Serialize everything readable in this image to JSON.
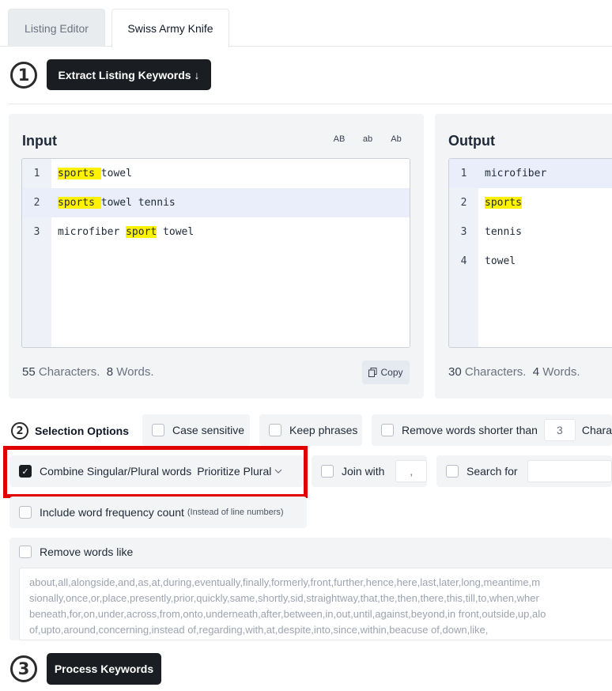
{
  "tabs": [
    {
      "label": "Listing Editor",
      "active": false
    },
    {
      "label": "Swiss Army Knife",
      "active": true
    }
  ],
  "step1": {
    "number": "1",
    "button": "Extract Listing Keywords ↓"
  },
  "input": {
    "title": "Input",
    "case_buttons": [
      "AB",
      "ab",
      "Ab"
    ],
    "lines": [
      {
        "n": "1",
        "parts": [
          {
            "t": "sports ",
            "hl": true
          },
          {
            "t": "towel",
            "hl": false
          }
        ]
      },
      {
        "n": "2",
        "parts": [
          {
            "t": "sports ",
            "hl": true
          },
          {
            "t": "towel tennis",
            "hl": false
          }
        ]
      },
      {
        "n": "3",
        "parts": [
          {
            "t": "microfiber ",
            "hl": false
          },
          {
            "t": "sport",
            "hl": true
          },
          {
            "t": " towel",
            "hl": false
          }
        ]
      }
    ],
    "char_count": "55",
    "char_label": "Characters.",
    "word_count": "8",
    "word_label": "Words.",
    "copy_label": "Copy"
  },
  "output": {
    "title": "Output",
    "lines": [
      {
        "n": "1",
        "parts": [
          {
            "t": "microfiber",
            "hl": false
          }
        ]
      },
      {
        "n": "2",
        "parts": [
          {
            "t": "sports",
            "hl": true
          }
        ]
      },
      {
        "n": "3",
        "parts": [
          {
            "t": "tennis",
            "hl": false
          }
        ]
      },
      {
        "n": "4",
        "parts": [
          {
            "t": "towel",
            "hl": false
          }
        ]
      }
    ],
    "char_count": "30",
    "char_label": "Characters.",
    "word_count": "4",
    "word_label": "Words."
  },
  "options": {
    "step_number": "2",
    "label": "Selection Options",
    "case_sensitive": "Case sensitive",
    "keep_phrases": "Keep phrases",
    "remove_shorter": "Remove words shorter than",
    "remove_shorter_value": "3",
    "remove_shorter_suffix": "Chara",
    "combine": "Combine Singular/Plural words",
    "prioritize": "Prioritize Plural",
    "join_with": "Join with",
    "join_value": ",",
    "search_for": "Search for",
    "include_freq": "Include word frequency count",
    "include_freq_note": "(Instead of line numbers)",
    "remove_like": "Remove words like",
    "remove_like_lines": [
      "about,all,alongside,and,as,at,during,eventually,finally,formerly,front,further,hence,here,last,later,long,meantime,m",
      "sionally,once,or,place,presently,prior,quickly,same,shortly,sid,straightway,that,the,then,there,this,till,to,when,wher",
      "beneath,for,on,under,across,from,onto,underneath,after,between,in,out,until,against,beyond,in front,outside,up,alo",
      "of,upto,around,concerning,instead of,regarding,with,at,despite,into,since,within,beacuse of,down,like,"
    ]
  },
  "step3": {
    "number": "3",
    "button": "Process Keywords"
  },
  "colors": {
    "highlight": "#fff200",
    "annotation": "#e00000",
    "button": "#1a1d21"
  }
}
